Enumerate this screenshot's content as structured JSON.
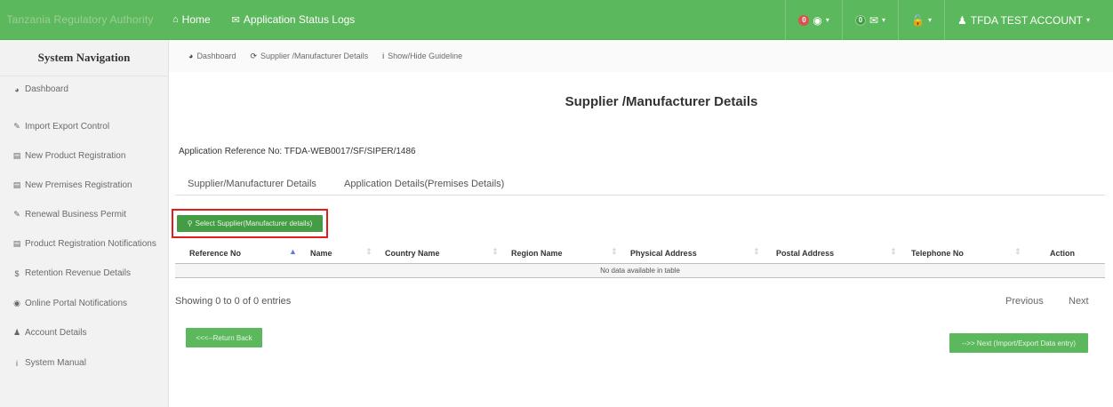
{
  "topbar": {
    "brand": "Tanzania Regulatory Authority",
    "home_label": "Home",
    "home_icon": "home-icon",
    "status_logs_label": "Application Status Logs",
    "status_logs_icon": "comments-icon",
    "notifications_count": "0",
    "messages_count": "0",
    "account_label": "TFDA TEST ACCOUNT",
    "colors": {
      "bar": "#5cb85c",
      "badge_red": "#d9534f"
    }
  },
  "sidebar": {
    "title": "System Navigation",
    "items": [
      {
        "label": "Dashboard",
        "icon": "dashboard-icon"
      },
      {
        "label": "Import Export Control",
        "icon": "pencil-icon"
      },
      {
        "label": "New Product Registration",
        "icon": "folder-icon"
      },
      {
        "label": "New Premises Registration",
        "icon": "folder-icon"
      },
      {
        "label": "Renewal Business Permit",
        "icon": "pencil-icon"
      },
      {
        "label": "Product Registration Notifications",
        "icon": "folder-icon"
      },
      {
        "label": "Retention Revenue Details",
        "icon": "dollar-icon"
      },
      {
        "label": "Online Portal Notifications",
        "icon": "globe-icon"
      },
      {
        "label": "Account Details",
        "icon": "user-icon"
      },
      {
        "label": "System Manual",
        "icon": "info-icon"
      }
    ]
  },
  "breadcrumb": {
    "dashboard": "Dashboard",
    "supplier": "Supplier /Manufacturer Details",
    "guideline": "Show/Hide Guideline"
  },
  "main": {
    "title": "Supplier /Manufacturer Details",
    "app_ref": "Application Reference No: TFDA-WEB0017/SF/SIPER/1486",
    "tabs": [
      {
        "label": "Supplier/Manufacturer Details"
      },
      {
        "label": "Application Details(Premises Details)"
      }
    ],
    "select_button": "Select Supplier(Manufacturer details)",
    "table": {
      "columns": [
        "Reference No",
        "Name",
        "Country Name",
        "Region Name",
        "Physical Address",
        "Postal Address",
        "Telephone No",
        "Action"
      ],
      "empty_message": "No data available in table"
    },
    "showing": "Showing 0 to 0 of 0 entries",
    "previous": "Previous",
    "next": "Next",
    "back_button": "<<<--Return Back",
    "next_button": "-->> Next (Import/Export Data entry)"
  }
}
